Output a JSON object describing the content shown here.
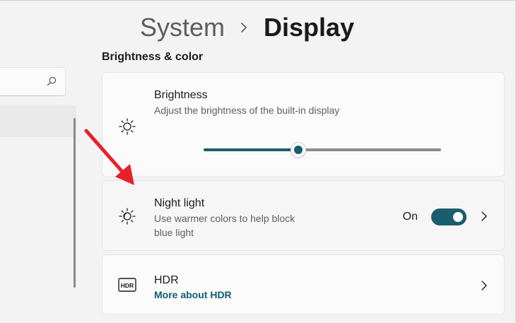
{
  "header": {
    "parent": "System",
    "separator_icon": "chevron-right-icon",
    "current": "Display"
  },
  "nav": {
    "search_icon": "search-icon"
  },
  "section": {
    "title": "Brightness & color"
  },
  "brightness": {
    "icon": "sun-icon",
    "title": "Brightness",
    "description": "Adjust the brightness of the built-in display",
    "slider_value_percent": 40
  },
  "night_light": {
    "icon": "night-light-icon",
    "title": "Night light",
    "description_line1": "Use warmer colors to help block",
    "description_line2": "blue light",
    "toggle_label": "On",
    "toggle_on": true,
    "chevron_icon": "chevron-right-icon"
  },
  "hdr": {
    "icon": "hdr-icon",
    "icon_text": "HDR",
    "title": "HDR",
    "link": "More about HDR",
    "chevron_icon": "chevron-right-icon"
  },
  "annotation": {
    "arrow_icon": "red-arrow-icon"
  },
  "colors": {
    "accent": "#1a5d6d",
    "link": "#0f5d76",
    "background": "#f3f3f3",
    "card": "#fbfbfb",
    "annotation": "#e8202a"
  }
}
